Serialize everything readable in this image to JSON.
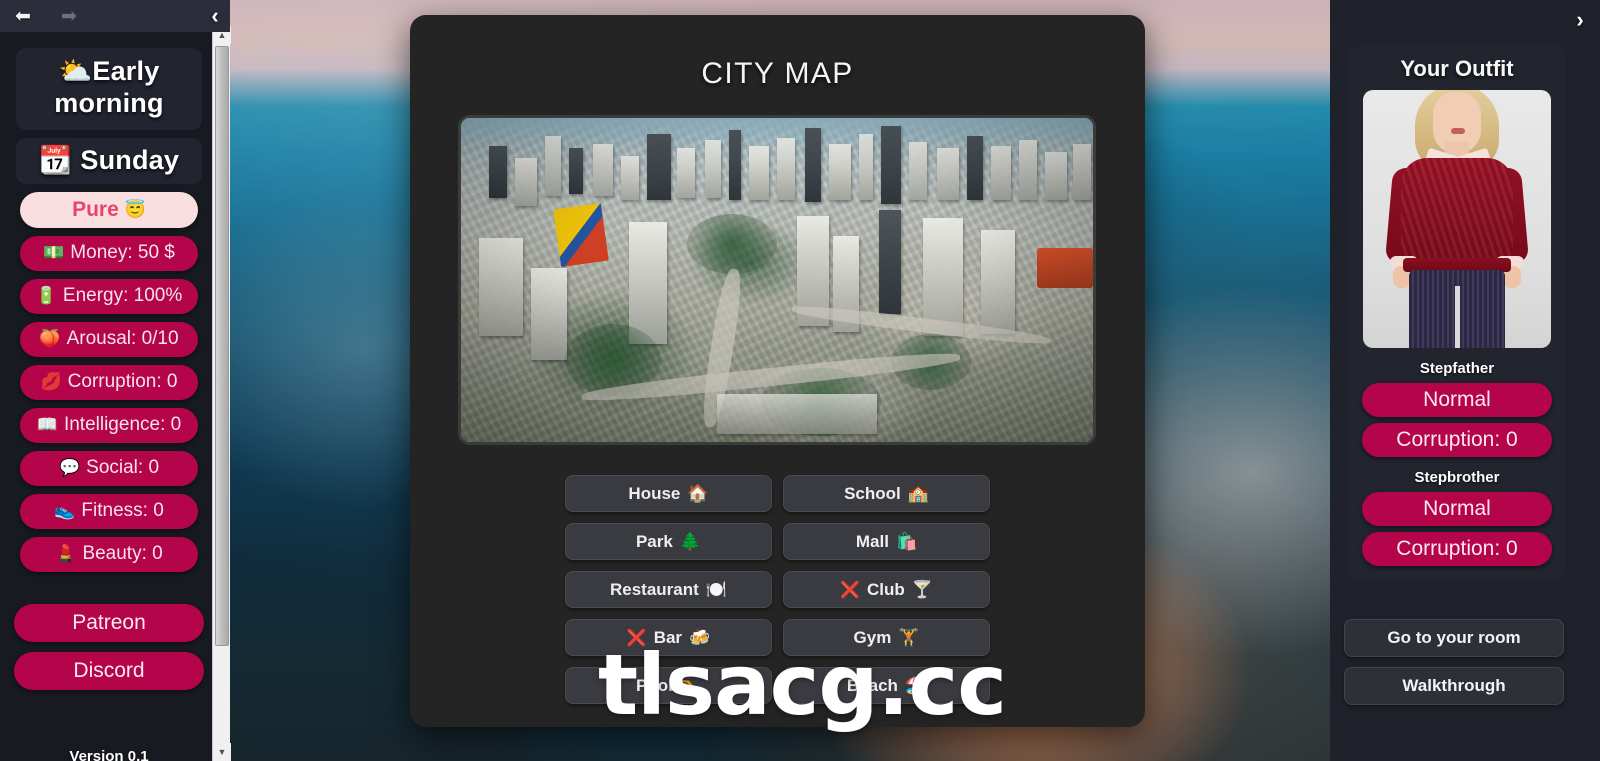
{
  "browser": {
    "back_icon": "back-arrow-icon",
    "forward_icon": "forward-arrow-icon",
    "back_glyph": "⬅",
    "forward_glyph": "➡",
    "collapse_left_glyph": "‹",
    "collapse_right_glyph": "›"
  },
  "sidebar": {
    "time_line1": "⛅Early",
    "time_line2": "morning",
    "day": "📆 Sunday",
    "purity": {
      "label": "Pure",
      "emoji": "😇"
    },
    "stats": [
      {
        "emoji": "💵",
        "label": "Money: 50 $"
      },
      {
        "emoji": "🔋",
        "label": "Energy: 100%"
      },
      {
        "emoji": "🍑",
        "label": "Arousal: 0/10"
      },
      {
        "emoji": "💋",
        "label": "Corruption: 0"
      },
      {
        "emoji": "📖",
        "label": "Intelligence: 0"
      },
      {
        "emoji": "💬",
        "label": "Social: 0"
      },
      {
        "emoji": "👟",
        "label": "Fitness: 0"
      },
      {
        "emoji": "💄",
        "label": "Beauty: 0"
      }
    ],
    "links": [
      {
        "label": "Patreon"
      },
      {
        "label": "Discord"
      }
    ],
    "version": "Version 0.1"
  },
  "modal": {
    "title": "CITY MAP",
    "map_image_alt": "aerial-city-photo",
    "locations": [
      {
        "label": "House",
        "emoji": "🏠",
        "locked": false
      },
      {
        "label": "School",
        "emoji": "🏫",
        "locked": false
      },
      {
        "label": "Park",
        "emoji": "🌲",
        "locked": false
      },
      {
        "label": "Mall",
        "emoji": "🛍️",
        "locked": false
      },
      {
        "label": "Restaurant",
        "emoji": "🍽️",
        "locked": false
      },
      {
        "label": "Club",
        "emoji": "🍸",
        "locked": true
      },
      {
        "label": "Bar",
        "emoji": "🍻",
        "locked": true
      },
      {
        "label": "Gym",
        "emoji": "🏋️",
        "locked": false
      },
      {
        "label": "Pool",
        "emoji": "🏊",
        "locked": false
      },
      {
        "label": "Beach",
        "emoji": "🏖️",
        "locked": false
      }
    ],
    "lock_mark": "❌"
  },
  "right_panel": {
    "outfit_title": "Your Outfit",
    "outfit_alt": "outfit-photo-red-sweater",
    "relationships": [
      {
        "name": "Stepfather",
        "status": "Normal",
        "corruption": "Corruption: 0"
      },
      {
        "name": "Stepbrother",
        "status": "Normal",
        "corruption": "Corruption: 0"
      }
    ],
    "actions": [
      {
        "label": "Go to your room"
      },
      {
        "label": "Walkthrough"
      }
    ]
  },
  "watermark": {
    "text": "tlsacg.cc"
  },
  "colors": {
    "accent_pill": "#b4054a",
    "purity_bg": "#f9dfe0",
    "purity_text": "#e8456e",
    "modal_bg": "#242424",
    "locked_x": "#ed2a4f",
    "sidebar_bg": "#181a21"
  }
}
